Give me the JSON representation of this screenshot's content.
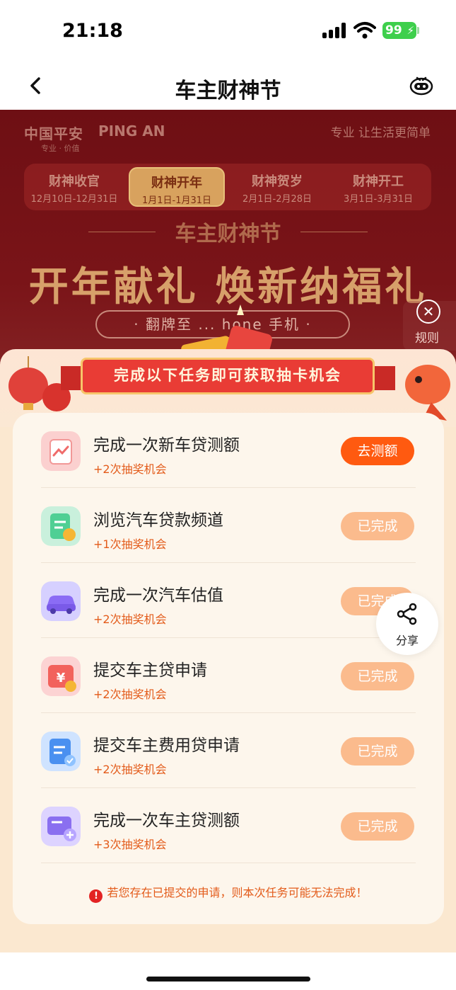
{
  "status": {
    "time": "21:18",
    "battery": "99"
  },
  "nav": {
    "title": "车主财神节"
  },
  "banner": {
    "brand_cn": "中国平安",
    "brand_en": "PING AN",
    "brand_sub": "专业 · 价值",
    "slogan": "专业 让生活更简单",
    "phases": [
      {
        "name": "财神收官",
        "date": "12月10日-12月31日",
        "active": false
      },
      {
        "name": "财神开年",
        "date": "1月1日-1月31日",
        "active": true
      },
      {
        "name": "财神贺岁",
        "date": "2月1日-2月28日",
        "active": false
      },
      {
        "name": "财神开工",
        "date": "3月1日-3月31日",
        "active": false
      }
    ],
    "hero_sub": "车主财神节",
    "hero_title": "开年献礼 焕新纳福礼",
    "hero_prize": "· 翻牌至 ... hone 手机 ·",
    "rules_label": "规则"
  },
  "tasks_header": {
    "ribbon": "完成以下任务即可获取抽卡机会"
  },
  "tasks": [
    {
      "title": "完成一次新车贷测额",
      "reward": "+2次抽奖机会",
      "button": "去测额",
      "state": "go",
      "icon": "chart-report-icon",
      "color": "#fbd0cf"
    },
    {
      "title": "浏览汽车贷款频道",
      "reward": "+1次抽奖机会",
      "button": "已完成",
      "state": "done",
      "icon": "clipboard-coin-icon",
      "color": "#c9f0dc"
    },
    {
      "title": "完成一次汽车估值",
      "reward": "+2次抽奖机会",
      "button": "已完成",
      "state": "done",
      "icon": "car-icon",
      "color": "#d6d0ff"
    },
    {
      "title": "提交车主贷申请",
      "reward": "+2次抽奖机会",
      "button": "已完成",
      "state": "done",
      "icon": "yuan-calendar-icon",
      "color": "#fcd3d3"
    },
    {
      "title": "提交车主费用贷申请",
      "reward": "+2次抽奖机会",
      "button": "已完成",
      "state": "done",
      "icon": "document-check-icon",
      "color": "#cfe3ff"
    },
    {
      "title": "完成一次车主贷测额",
      "reward": "+3次抽奖机会",
      "button": "已完成",
      "state": "done",
      "icon": "card-plus-icon",
      "color": "#ddd3ff"
    }
  ],
  "notice": {
    "icon_text": "!",
    "text": "若您存在已提交的申请，则本次任务可能无法完成！"
  },
  "share": {
    "label": "分享"
  }
}
